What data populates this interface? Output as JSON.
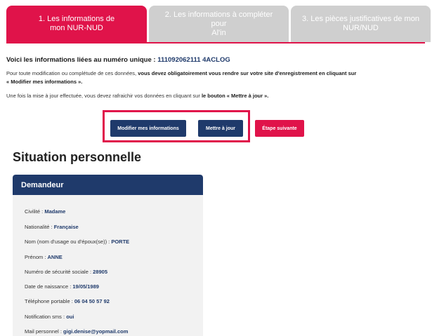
{
  "tabs": [
    {
      "label_line1": "1. Les informations de",
      "label_line2": "mon NUR-NUD"
    },
    {
      "label_line1": "2. Les informations à compléter pour",
      "label_line2": "Al'in"
    },
    {
      "label_line1": "3. Les pièces justificatives de mon",
      "label_line2": "NUR/NUD"
    }
  ],
  "info": {
    "prefix": "Voici les informations liées au numéro unique : ",
    "number": "111092062111 4ACLOG"
  },
  "para1": {
    "text": "Pour toute modification ou complétude de ces données, ",
    "bold": "vous devez obligatoirement vous rendre sur votre site d'enregistrement en cliquant sur",
    "bold2": "« Modifier mes informations »."
  },
  "para2": {
    "text": "Une fois la mise à jour effectuée, vous devez rafraichir vos données en cliquant sur ",
    "bold": "le bouton « Mettre à jour »."
  },
  "buttons": {
    "modify": "Modifier mes informations",
    "update": "Mettre à jour",
    "next": "Étape suivante"
  },
  "section_title": "Situation personnelle",
  "card": {
    "title": "Demandeur",
    "fields": [
      {
        "label": "Civilité : ",
        "value": "Madame"
      },
      {
        "label": "Nationalité : ",
        "value": "Française"
      },
      {
        "label": "Nom (nom d'usage ou d'époux(se)) : ",
        "value": "PORTE"
      },
      {
        "label": "Prénom : ",
        "value": "ANNE"
      },
      {
        "label": "Numéro de sécurité sociale : ",
        "value": "28905"
      },
      {
        "label": "Date de naissance : ",
        "value": "19/05/1989"
      },
      {
        "label": "Téléphone portable : ",
        "value": "06 04 50 57 92"
      },
      {
        "label": "Notification sms : ",
        "value": "oui"
      },
      {
        "label": "Mail personnel : ",
        "value": "gigi.denise@yopmail.com"
      }
    ]
  },
  "colors": {
    "accent": "#e0134a",
    "navy": "#1f3a6b",
    "tab_inactive": "#cfcfcf",
    "card_bg": "#f2f2f2"
  }
}
